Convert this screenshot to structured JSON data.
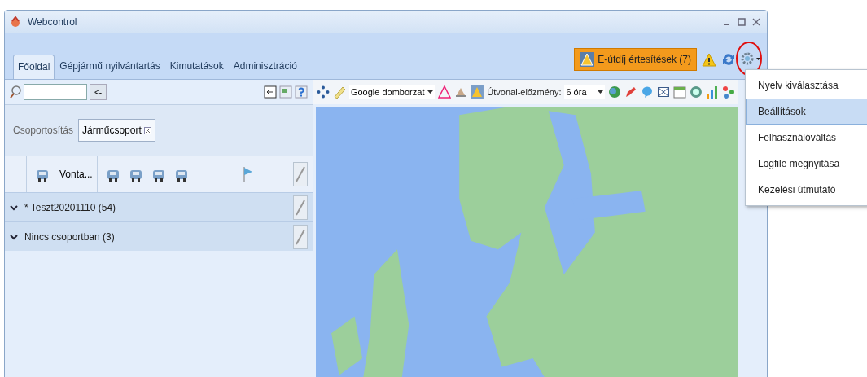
{
  "window": {
    "title": "Webcontrol"
  },
  "tabs": [
    {
      "label": "Főoldal",
      "selected": true
    },
    {
      "label": "Gépjármű nyilvántartás",
      "selected": false
    },
    {
      "label": "Kimutatások",
      "selected": false
    },
    {
      "label": "Adminisztráció",
      "selected": false
    }
  ],
  "notification_button": {
    "label": "E-útdíj értesítések (7)"
  },
  "search": {
    "back_button": "<-"
  },
  "map_toolbar": {
    "map_type": "Google domborzat",
    "history_label": "Útvonal-előzmény:",
    "history_value": "6 óra"
  },
  "grouping": {
    "label": "Csoportosítás",
    "chips": [
      {
        "label": "Járműcsoport"
      }
    ]
  },
  "columns": [
    {
      "kind": "icon"
    },
    {
      "kind": "text",
      "label": "Vonta..."
    },
    {
      "kind": "icon"
    },
    {
      "kind": "icon"
    },
    {
      "kind": "icon"
    },
    {
      "kind": "icon"
    },
    {
      "kind": "flag"
    }
  ],
  "groups": [
    {
      "label": "* Teszt20201110 (54)"
    },
    {
      "label": "Nincs csoportban (3)"
    }
  ],
  "settings_menu": {
    "items": [
      {
        "label": "Nyelv kiválasztása",
        "selected": false
      },
      {
        "label": "Beállítások",
        "selected": true
      },
      {
        "label": "Felhasználóváltás",
        "selected": false
      },
      {
        "label": "Logfile megnyitása",
        "selected": false
      },
      {
        "label": "Kezelési útmutató",
        "selected": false
      }
    ]
  }
}
